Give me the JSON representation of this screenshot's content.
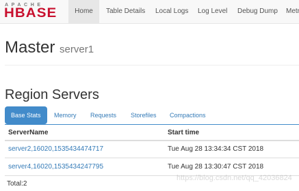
{
  "navbar": {
    "logo": {
      "top": "APACHE",
      "main": "HBASE"
    },
    "items": [
      {
        "label": "Home",
        "active": true
      },
      {
        "label": "Table Details"
      },
      {
        "label": "Local Logs"
      },
      {
        "label": "Log Level"
      },
      {
        "label": "Debug Dump"
      },
      {
        "label": "Metr"
      }
    ]
  },
  "master": {
    "title": "Master",
    "server": "server1"
  },
  "region_servers": {
    "title": "Region Servers",
    "tabs": [
      {
        "label": "Base Stats",
        "active": true
      },
      {
        "label": "Memory"
      },
      {
        "label": "Requests"
      },
      {
        "label": "Storefiles"
      },
      {
        "label": "Compactions"
      }
    ],
    "columns": [
      "ServerName",
      "Start time"
    ],
    "rows": [
      {
        "server": "server2,16020,1535434474717",
        "start": "Tue Aug 28 13:34:34 CST 2018"
      },
      {
        "server": "server4,16020,1535434247795",
        "start": "Tue Aug 28 13:30:47 CST 2018"
      }
    ],
    "total": "Total:2"
  },
  "watermark": "https://blog.csdn.net/qq_42036824",
  "colors": {
    "accent": "#428bca",
    "link": "#337ab7",
    "logo_red": "#c8102e"
  }
}
